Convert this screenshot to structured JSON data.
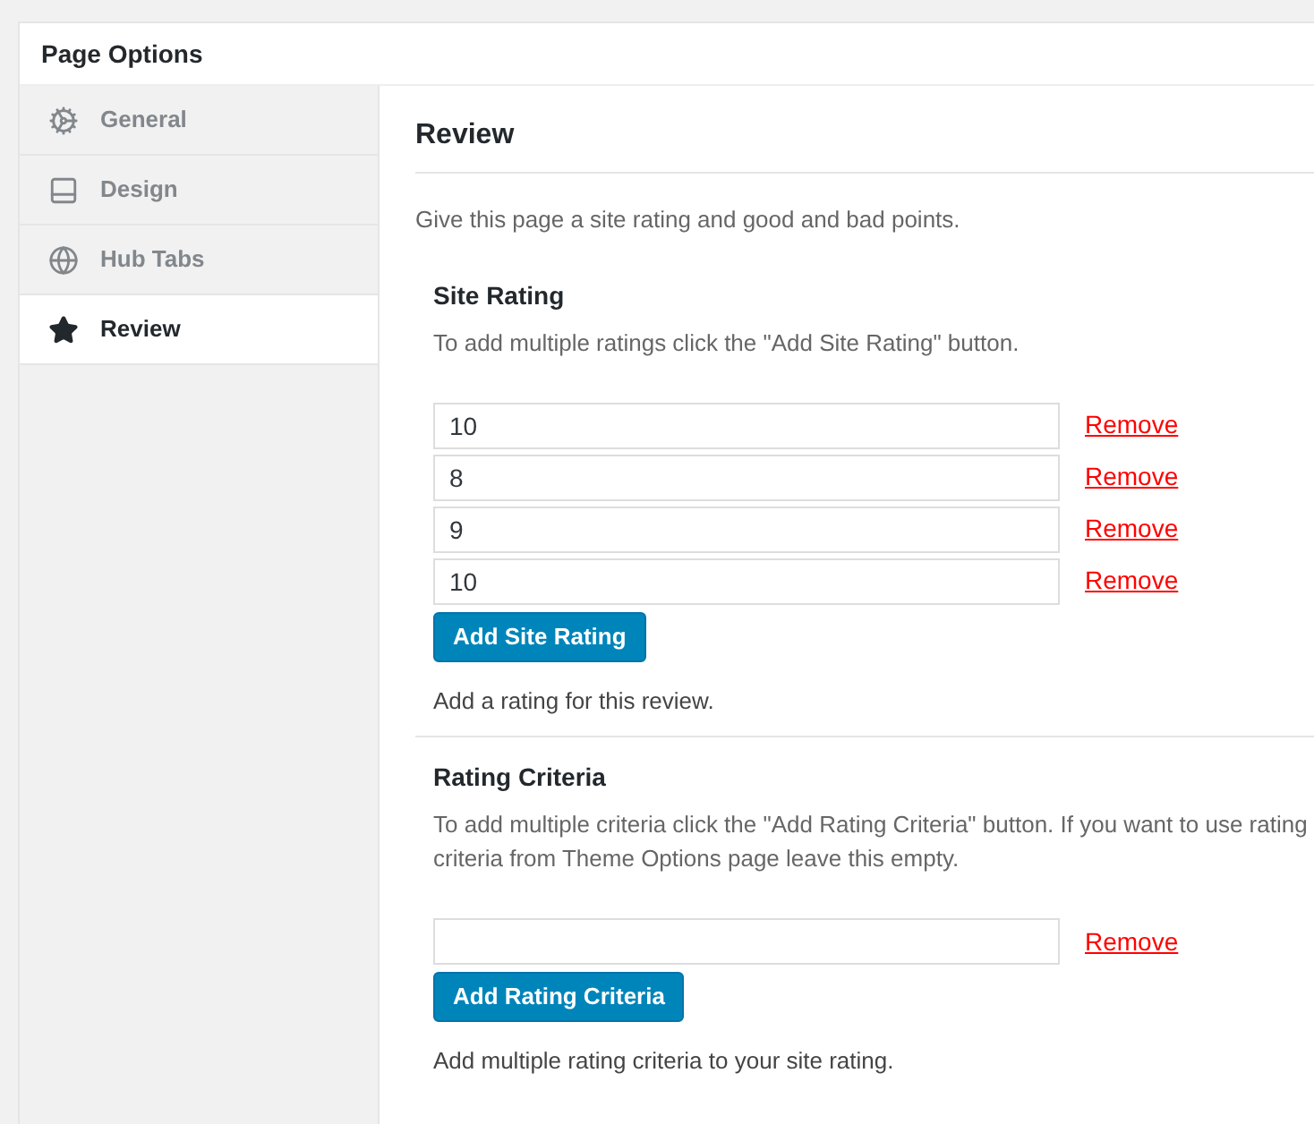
{
  "panel": {
    "title": "Page Options"
  },
  "sidebar": {
    "items": [
      {
        "label": "General",
        "selected": false
      },
      {
        "label": "Design",
        "selected": false
      },
      {
        "label": "Hub Tabs",
        "selected": false
      },
      {
        "label": "Review",
        "selected": true
      }
    ]
  },
  "content": {
    "title": "Review",
    "intro": "Give this page a site rating and good and bad points.",
    "sections": [
      {
        "title": "Site Rating",
        "description": "To add multiple ratings click the \"Add Site Rating\" button.",
        "rows": [
          {
            "value": "10",
            "remove": "Remove"
          },
          {
            "value": "8",
            "remove": "Remove"
          },
          {
            "value": "9",
            "remove": "Remove"
          },
          {
            "value": "10",
            "remove": "Remove"
          }
        ],
        "button": "Add Site Rating",
        "help": "Add a rating for this review."
      },
      {
        "title": "Rating Criteria",
        "description": "To add multiple criteria click the \"Add Rating Criteria\" button. If you want to use rating criteria from Theme Options page leave this empty.",
        "rows": [
          {
            "value": "",
            "remove": "Remove"
          }
        ],
        "button": "Add Rating Criteria",
        "help": "Add multiple rating criteria to your site rating."
      }
    ]
  }
}
